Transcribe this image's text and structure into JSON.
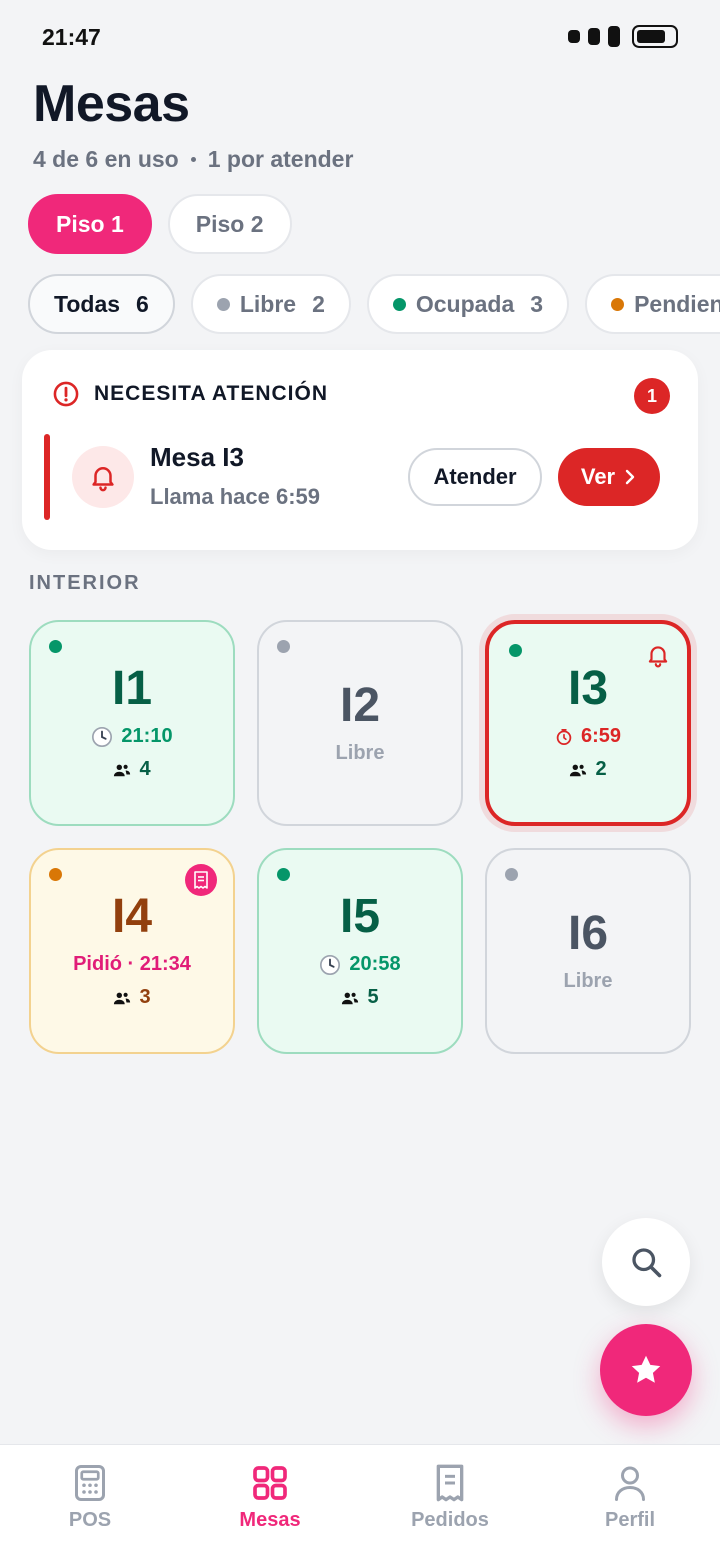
{
  "status": {
    "time": "21:47"
  },
  "header": {
    "title": "Mesas",
    "in_use": "4 de 6 en uso",
    "to_attend": "1 por atender"
  },
  "floors": [
    {
      "label": "Piso 1",
      "active": true
    },
    {
      "label": "Piso 2",
      "active": false
    }
  ],
  "filters": [
    {
      "label": "Todas",
      "count": "6",
      "color": ""
    },
    {
      "label": "Libre",
      "count": "2",
      "color": "#9ca3af"
    },
    {
      "label": "Ocupada",
      "count": "3",
      "color": "#059669"
    },
    {
      "label": "Pendiente",
      "count": "",
      "color": "#d97706"
    }
  ],
  "alert": {
    "title": "NECESITA ATENCIÓN",
    "count": "1",
    "table": "Mesa I3",
    "time": "Llama hace 6:59",
    "attend_label": "Atender",
    "view_label": "Ver"
  },
  "section": {
    "label": "INTERIOR"
  },
  "tables": [
    {
      "code": "I1",
      "state": "occupied",
      "time": "21:10",
      "guests": "4"
    },
    {
      "code": "I2",
      "state": "free",
      "status_label": "Libre"
    },
    {
      "code": "I3",
      "state": "alert",
      "time": "6:59",
      "guests": "2"
    },
    {
      "code": "I4",
      "state": "pending",
      "order": "Pidió · 21:34",
      "guests": "3"
    },
    {
      "code": "I5",
      "state": "occupied",
      "time": "20:58",
      "guests": "5"
    },
    {
      "code": "I6",
      "state": "free",
      "status_label": "Libre"
    }
  ],
  "colors": {
    "accent": "#f0287a",
    "danger": "#dc2626",
    "occupied": "#059669",
    "pending": "#d97706",
    "free": "#9ca3af"
  },
  "nav": [
    {
      "label": "POS",
      "icon": "calculator-icon",
      "active": false
    },
    {
      "label": "Mesas",
      "icon": "grid-icon",
      "active": true
    },
    {
      "label": "Pedidos",
      "icon": "receipt-icon",
      "active": false
    },
    {
      "label": "Perfil",
      "icon": "user-icon",
      "active": false
    }
  ]
}
